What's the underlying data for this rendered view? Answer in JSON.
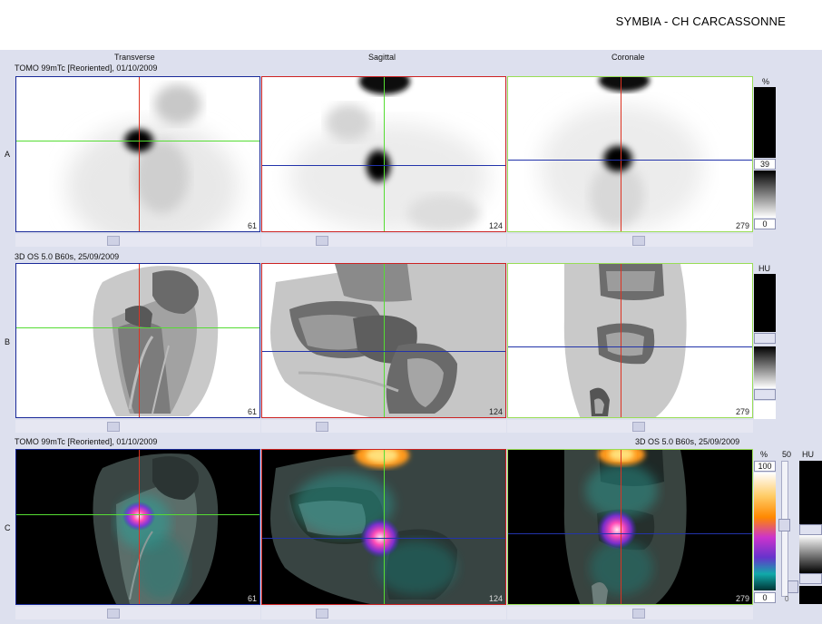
{
  "header": {
    "site": "SYMBIA - CH CARCASSONNE"
  },
  "columns": {
    "transverse": "Transverse",
    "sagittal": "Sagittal",
    "coronal": "Coronale"
  },
  "rows": {
    "a": {
      "label": "A",
      "series": "TOMO 99mTc [Reoriented], 01/10/2009"
    },
    "b": {
      "label": "B",
      "series": "3D  OS  5.0  B60s, 25/09/2009"
    },
    "c": {
      "label": "C",
      "series_left": "TOMO 99mTc [Reoriented], 01/10/2009",
      "series_right": "3D  OS  5.0  B60s, 25/09/2009"
    }
  },
  "slices": {
    "transverse": "61",
    "sagittal": "124",
    "coronal": "279"
  },
  "colorbars": {
    "a": {
      "unit": "%",
      "upper": "39",
      "lower": "0"
    },
    "b": {
      "unit": "HU"
    },
    "c": {
      "unit_pct": "%",
      "max": "100",
      "min": "0",
      "ct_value": "50",
      "unit_hu": "HU",
      "ct_min": "0"
    }
  },
  "colors": {
    "crosshair_vertical": "#dd3322",
    "crosshair_horizontal_axial": "#55dd33",
    "crosshair_horizontal_other": "#2233aa",
    "frame_transverse": "#1a2a99",
    "frame_sagittal": "#cc2222",
    "frame_coronal": "#99dd55"
  }
}
